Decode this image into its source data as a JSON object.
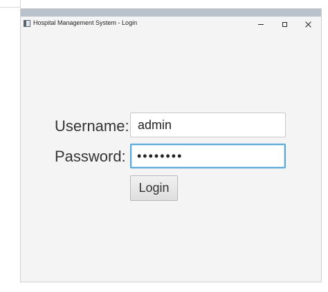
{
  "window": {
    "title": "Hospital Management System - Login",
    "icon": "app-window-icon",
    "controls": {
      "minimize_icon": "minimize-icon",
      "maximize_icon": "maximize-icon",
      "close_icon": "close-icon"
    }
  },
  "login_form": {
    "username_label": "Username:",
    "username_value": "admin",
    "password_label": "Password:",
    "password_value": "adminpwd",
    "login_button_label": "Login"
  },
  "colors": {
    "window_background": "#f4f4f4",
    "focused_border": "#59a9d8"
  }
}
